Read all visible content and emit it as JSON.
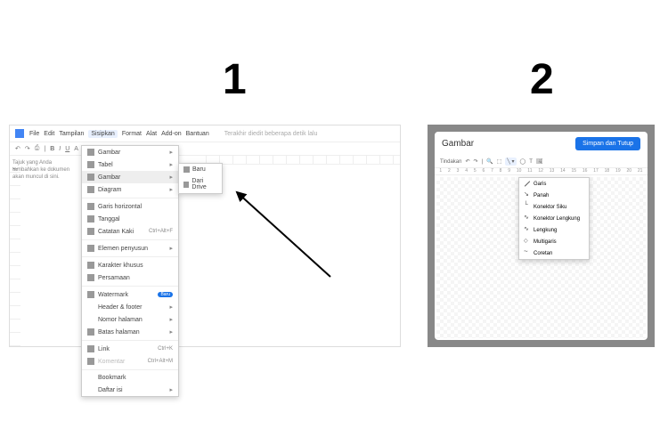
{
  "labels": {
    "one": "1",
    "two": "2"
  },
  "panel1": {
    "menu": [
      "File",
      "Edit",
      "Tampilan",
      "Sisipkan",
      "Format",
      "Alat",
      "Add-on",
      "Bantuan"
    ],
    "menu_active_index": 3,
    "status": "Terakhir diedit beberapa detik lalu",
    "sidebar_hint": "Tajuk yang Anda tambahkan ke dokumen akan muncul di sini.",
    "dropdown": [
      {
        "icon": "image-icon",
        "label": "Gambar",
        "sub": true
      },
      {
        "icon": "table-icon",
        "label": "Tabel",
        "sub": true
      },
      {
        "icon": "drawing-icon",
        "label": "Gambar",
        "sub": true,
        "hov": true
      },
      {
        "icon": "chart-icon",
        "label": "Diagram",
        "sub": true
      },
      {
        "sep": true
      },
      {
        "icon": "hr-icon",
        "label": "Garis horizontal"
      },
      {
        "icon": "date-icon",
        "label": "Tanggal"
      },
      {
        "icon": "footnote-icon",
        "label": "Catatan Kaki",
        "sc": "Ctrl+Alt+F"
      },
      {
        "sep": true
      },
      {
        "icon": "blocks-icon",
        "label": "Elemen penyusun",
        "sub": true
      },
      {
        "sep": true
      },
      {
        "icon": "omega-icon",
        "label": "Karakter khusus"
      },
      {
        "icon": "pi-icon",
        "label": "Persamaan"
      },
      {
        "sep": true
      },
      {
        "icon": "watermark-icon",
        "label": "Watermark",
        "badge": "Baru"
      },
      {
        "label": "Header & footer",
        "sub": true
      },
      {
        "label": "Nomor halaman",
        "sub": true
      },
      {
        "icon": "break-icon",
        "label": "Batas halaman",
        "sub": true
      },
      {
        "sep": true
      },
      {
        "icon": "link-icon",
        "label": "Link",
        "sc": "Ctrl+K"
      },
      {
        "icon": "comment-icon",
        "label": "Komentar",
        "sc": "Ctrl+Alt+M",
        "dis": true
      },
      {
        "sep": true
      },
      {
        "label": "Bookmark"
      },
      {
        "label": "Daftar isi",
        "sub": true
      }
    ],
    "submenu": [
      {
        "icon": "plus-icon",
        "label": "Baru"
      },
      {
        "icon": "drive-icon",
        "label": "Dari Drive"
      }
    ]
  },
  "panel2": {
    "title": "Gambar",
    "button": "Simpan dan Tutup",
    "toolbar_left": "Tindakan",
    "ruler": [
      "1",
      "2",
      "3",
      "4",
      "5",
      "6",
      "7",
      "8",
      "9",
      "10",
      "11",
      "12",
      "13",
      "14",
      "15",
      "16",
      "17",
      "18",
      "19",
      "20",
      "21"
    ],
    "line_menu": [
      {
        "ic": "ic-line",
        "label": "Garis"
      },
      {
        "ic": "ic-arr",
        "label": "Panah"
      },
      {
        "ic": "ic-elb",
        "label": "Konektor Siku"
      },
      {
        "ic": "ic-cur",
        "label": "Konektor Lengkung"
      },
      {
        "ic": "ic-cur",
        "label": "Lengkung"
      },
      {
        "ic": "ic-pol",
        "label": "Multigaris"
      },
      {
        "ic": "ic-scr",
        "label": "Coretan"
      }
    ]
  }
}
